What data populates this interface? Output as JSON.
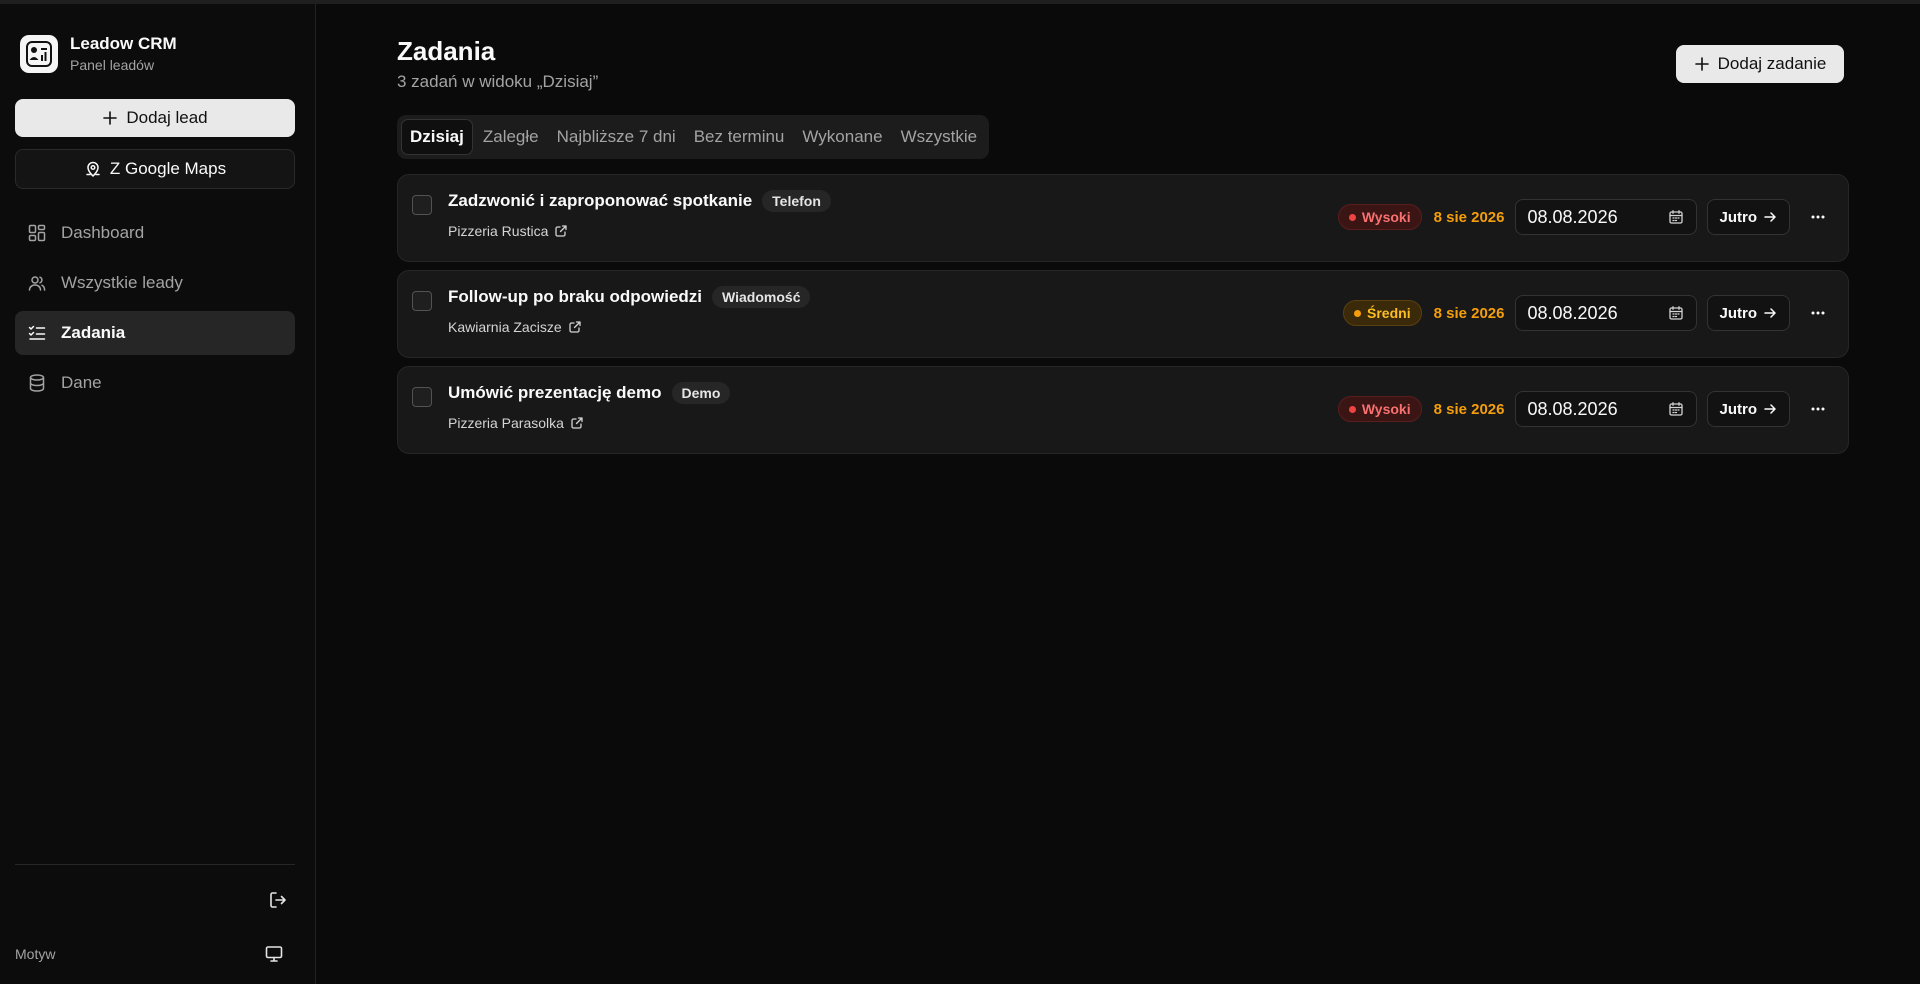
{
  "sidebar": {
    "brand_name": "Leadow CRM",
    "brand_sub": "Panel leadów",
    "add_lead_label": "Dodaj lead",
    "gmaps_label": "Z Google Maps",
    "nav": [
      {
        "label": "Dashboard",
        "icon": "dashboard-icon",
        "active": false
      },
      {
        "label": "Wszystkie leady",
        "icon": "users-icon",
        "active": false
      },
      {
        "label": "Zadania",
        "icon": "tasks-icon",
        "active": true
      },
      {
        "label": "Dane",
        "icon": "database-icon",
        "active": false
      }
    ],
    "theme_label": "Motyw"
  },
  "header": {
    "title": "Zadania",
    "subtitle": "3 zadań w widoku „Dzisiaj”",
    "add_task_label": "Dodaj zadanie"
  },
  "tabs": [
    {
      "label": "Dzisiaj",
      "active": true
    },
    {
      "label": "Zaległe",
      "active": false
    },
    {
      "label": "Najbliższe 7 dni",
      "active": false
    },
    {
      "label": "Bez terminu",
      "active": false
    },
    {
      "label": "Wykonane",
      "active": false
    },
    {
      "label": "Wszystkie",
      "active": false
    }
  ],
  "tasks": [
    {
      "title": "Zadzwonić i zaproponować spotkanie",
      "tag": "Telefon",
      "lead": "Pizzeria Rustica",
      "priority": "Wysoki",
      "priority_level": "high",
      "due": "8 sie 2026",
      "date": "08.08.2026",
      "tomorrow": "Jutro"
    },
    {
      "title": "Follow-up po braku odpowiedzi",
      "tag": "Wiadomość",
      "lead": "Kawiarnia Zacisze",
      "priority": "Średni",
      "priority_level": "mid",
      "due": "8 sie 2026",
      "date": "08.08.2026",
      "tomorrow": "Jutro"
    },
    {
      "title": "Umówić prezentację demo",
      "tag": "Demo",
      "lead": "Pizzeria Parasolka",
      "priority": "Wysoki",
      "priority_level": "high",
      "due": "8 sie 2026",
      "date": "08.08.2026",
      "tomorrow": "Jutro"
    }
  ],
  "colors": {
    "background": "#0a0a0a",
    "priority_high": "#ef4444",
    "priority_mid": "#f59e0b",
    "due_date": "#f59e0b"
  }
}
